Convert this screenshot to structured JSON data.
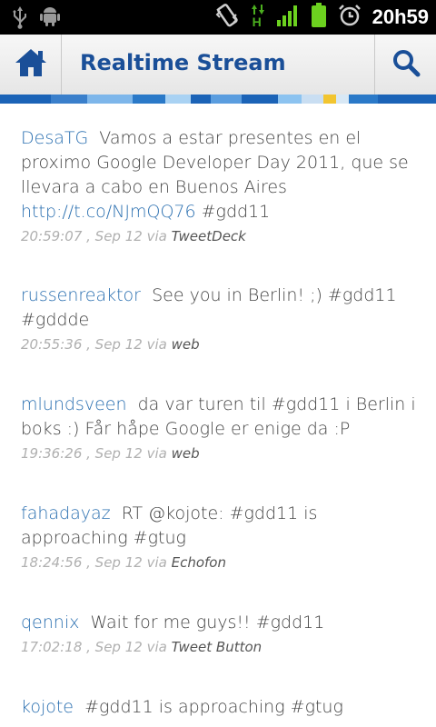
{
  "status_bar": {
    "time": "20h59",
    "icons": [
      "usb-icon",
      "android-debug-icon",
      "vibrate-icon",
      "hspa-data-icon",
      "signal-icon",
      "battery-icon",
      "alarm-icon"
    ],
    "network_type": "H"
  },
  "action_bar": {
    "title": "Realtime Stream",
    "home_icon": "home-icon",
    "search_icon": "search-icon"
  },
  "colors": {
    "title": "#1a4f98",
    "username": "#2a6fb0",
    "text": "#444444",
    "meta": "#b0b0b0",
    "stripe": [
      "#1b63b7",
      "#4a90d9",
      "#7db6ea",
      "#2a79c8",
      "#8cc3f0",
      "#f2c530",
      "#1b63b7"
    ]
  },
  "tweets": [
    {
      "user": "DesaTG",
      "text": "Vamos a estar presentes en el proximo Google Developer Day 2011, que se llevara a cabo en Buenos Aires",
      "link": "http://t.co/NJmQQ76",
      "tail": "#gdd11",
      "time": "20:59:07 , Sep 12 via",
      "source": "TweetDeck"
    },
    {
      "user": "russenreaktor",
      "text": "See you in Berlin! ;) #gdd11 #gddde",
      "link": "",
      "tail": "",
      "time": "20:55:36 , Sep 12 via",
      "source": "web"
    },
    {
      "user": "mlundsveen",
      "text": "da var turen til #gdd11 i Berlin i boks :) Får håpe Google er enige da :P",
      "link": "",
      "tail": "",
      "time": "19:36:26 , Sep 12 via",
      "source": "web"
    },
    {
      "user": "fahadayaz",
      "text": "RT @kojote: #gdd11 is approaching #gtug",
      "link": "",
      "tail": "",
      "time": "18:24:56 , Sep 12 via",
      "source": "Echofon"
    },
    {
      "user": "qennix",
      "text": "Wait for me guys!! #gdd11",
      "link": "",
      "tail": "",
      "time": "17:02:18 , Sep 12 via",
      "source": "Tweet Button"
    },
    {
      "user": "kojote",
      "text": "#gdd11 is approaching #gtug",
      "link": "",
      "tail": "",
      "time": "",
      "source": ""
    }
  ]
}
